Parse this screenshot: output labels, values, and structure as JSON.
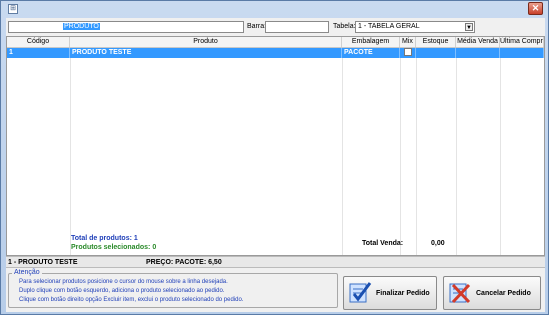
{
  "window": {
    "title_icon": "app-icon"
  },
  "filters": {
    "product_value": "PRODUTO",
    "barra_label": "Barra:",
    "barra_value": "",
    "tabela_label": "Tabela:",
    "tabela_value": "1 - TABELA GERAL"
  },
  "grid": {
    "columns": [
      "Código",
      "Produto",
      "Embalagem",
      "Mix",
      "Estoque",
      "Média Venda",
      "Última Compra"
    ],
    "rows": [
      {
        "codigo": "1",
        "produto": "PRODUTO TESTE",
        "embalagem": "PACOTE",
        "mix": false,
        "estoque": "",
        "media_venda": "",
        "ultima_compra": ""
      }
    ]
  },
  "totals": {
    "total_produtos_label": "Total de produtos:",
    "total_produtos_value": "1",
    "selecionados_label": "Produtos selecionados:",
    "selecionados_value": "0",
    "total_venda_label": "Total Venda:",
    "total_venda_value": "0,00"
  },
  "info": {
    "produto": "1 - PRODUTO TESTE",
    "preco": "PREÇO: PACOTE: 6,50"
  },
  "attention": {
    "title": "Atenção",
    "lines": [
      "Para selecionar produtos posicione o cursor do mouse sobre a linha desejada.",
      "Duplo clique com botão esquerdo, adiciona o produto selecionado ao pedido.",
      "Clique com botão direito opção Excluir item, exclui o produto selecionado do pedido."
    ]
  },
  "buttons": {
    "finalizar": "Finalizar Pedido",
    "cancelar": "Cancelar Pedido"
  },
  "colors": {
    "selection": "#3399ff",
    "total_blue": "#1f3fb8",
    "selected_green": "#2a8a2a"
  }
}
